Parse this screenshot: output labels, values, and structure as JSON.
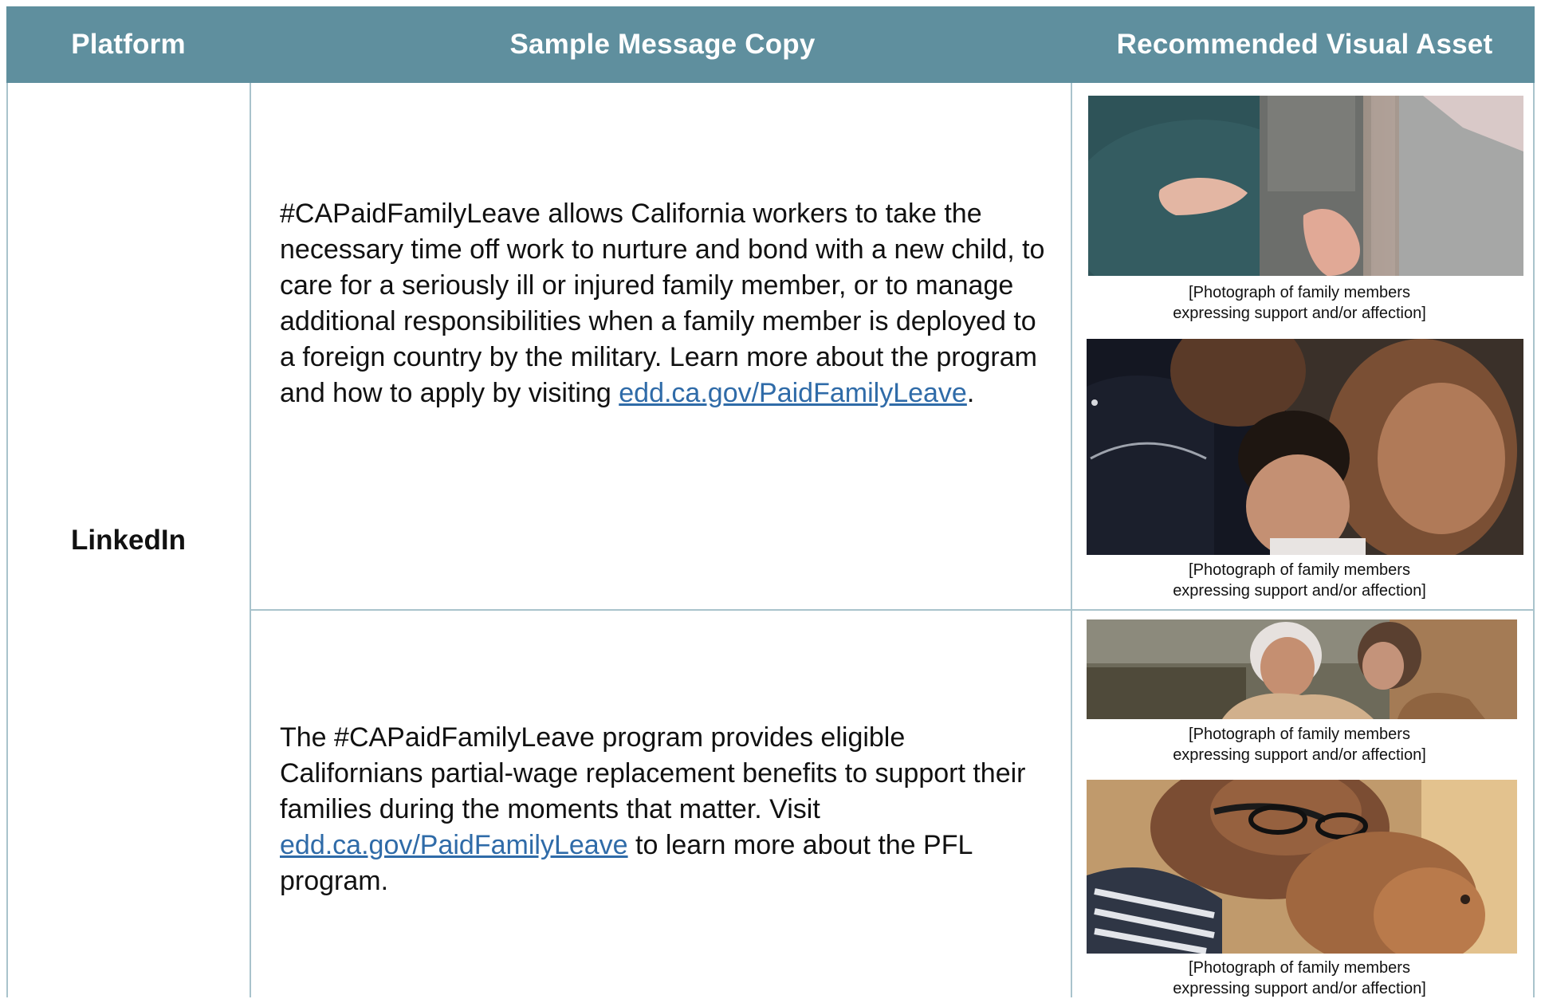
{
  "header": {
    "platform": "Platform",
    "copy": "Sample Message Copy",
    "visual": "Recommended Visual Asset"
  },
  "platform": "LinkedIn",
  "rows": [
    {
      "copy_before": "#CAPaidFamilyLeave allows California workers to take the necessary time off work to nurture and bond with a new child, to care for a seriously ill or injured family member, or to manage additional responsibilities when a family member is deployed to a foreign country by the military. Learn more about the program and how to apply by visiting ",
      "link": "edd.ca.gov/PaidFamilyLeave",
      "copy_after": ".",
      "captions": [
        "[Photograph of family members expressing support and/or affection]",
        "[Photograph of family members expressing support and/or affection]"
      ]
    },
    {
      "copy_before": "The #CAPaidFamilyLeave program provides eligible Californians partial-wage replacement benefits to support their families during the moments that matter. Visit ",
      "link": "edd.ca.gov/PaidFamilyLeave",
      "copy_after": " to learn more about the PFL program.",
      "captions": [
        "[Photograph of family members expressing support and/or affection]",
        "[Photograph of family members expressing support and/or affection]"
      ]
    }
  ],
  "colors": {
    "header_bg": "#5f8f9e",
    "border": "#a9c3cc",
    "link": "#2f6ba8"
  }
}
